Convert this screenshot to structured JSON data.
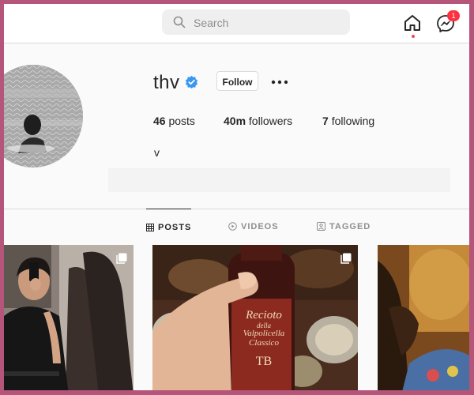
{
  "search": {
    "placeholder": "Search"
  },
  "nav": {
    "notification_badge": "1"
  },
  "profile": {
    "username": "thv",
    "follow_label": "Follow",
    "stats": {
      "posts_count": "46",
      "posts_label": "posts",
      "followers_count": "40m",
      "followers_label": "followers",
      "following_count": "7",
      "following_label": "following"
    },
    "bio": "v"
  },
  "tabs": [
    {
      "label": "POSTS",
      "active": true
    },
    {
      "label": "VIDEOS",
      "active": false
    },
    {
      "label": "TAGGED",
      "active": false
    }
  ],
  "posts": [
    {
      "description": "person taking mirror selfie"
    },
    {
      "label_lines": [
        "Recioto",
        "della",
        "Valpolicella",
        "Classico"
      ],
      "monogram": "TB"
    },
    {
      "description": "warm-toned photo"
    }
  ],
  "colors": {
    "frame": "#b5557a",
    "verified": "#3897f0",
    "badge": "#ff3040",
    "wine_label": "#f2d9b5"
  }
}
